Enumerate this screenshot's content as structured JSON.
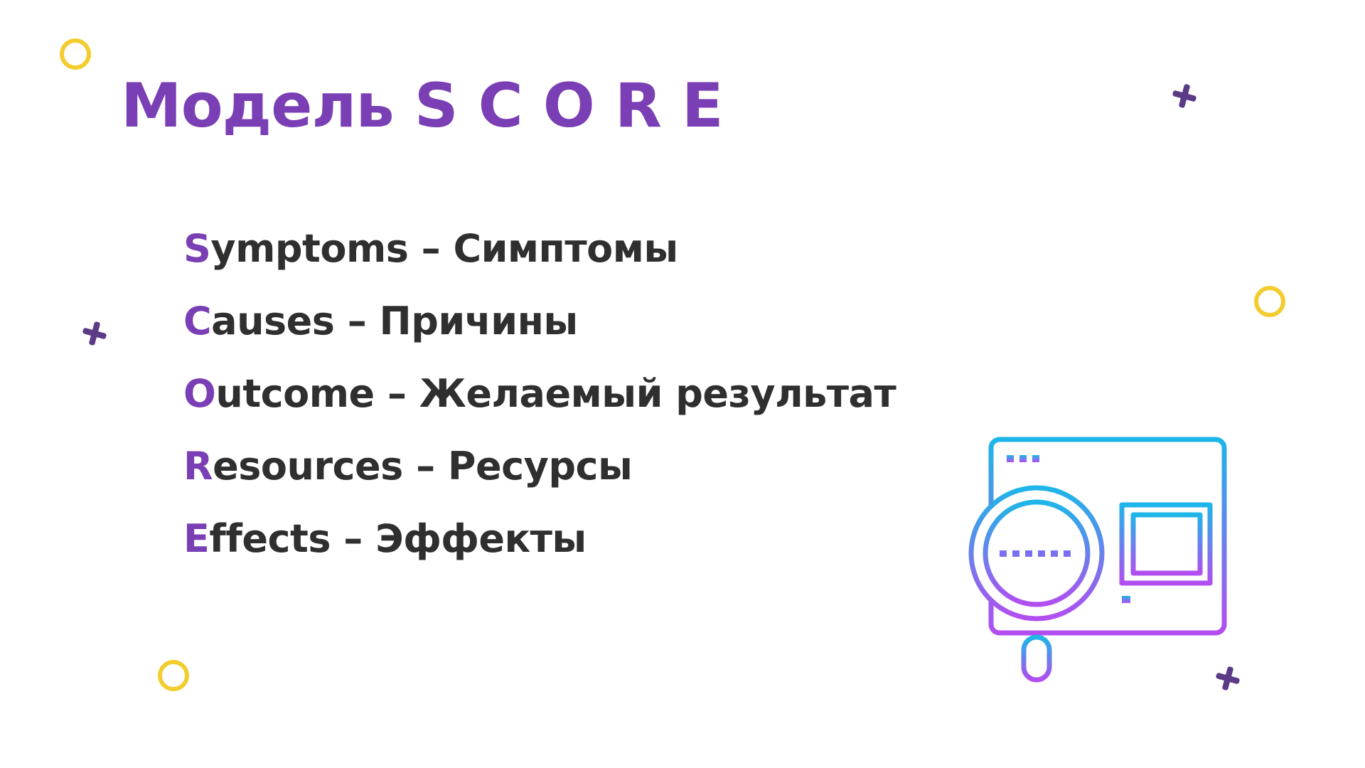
{
  "slide": {
    "title": "Модель S C O R E",
    "items": [
      {
        "letter": "S",
        "rest": "ymptoms – Симптомы"
      },
      {
        "letter": "C",
        "rest": "auses – Причины"
      },
      {
        "letter": "O",
        "rest": "utcome – Желаемый результат"
      },
      {
        "letter": "R",
        "rest": "esources – Ресурсы"
      },
      {
        "letter": "E",
        "rest": "ffects – Эффекты"
      }
    ]
  },
  "colors": {
    "accent": "#7a3fb4",
    "text": "#2f2f2f",
    "ring": "#f3cc2e",
    "plus": "#5b3a86",
    "icon_gradient_top": "#1eb6e8",
    "icon_gradient_bottom": "#b24ef0"
  },
  "icons": {
    "illustration": "magnifier-over-browser-window-icon",
    "decor_ring": "ring-icon",
    "decor_plus": "plus-icon"
  }
}
